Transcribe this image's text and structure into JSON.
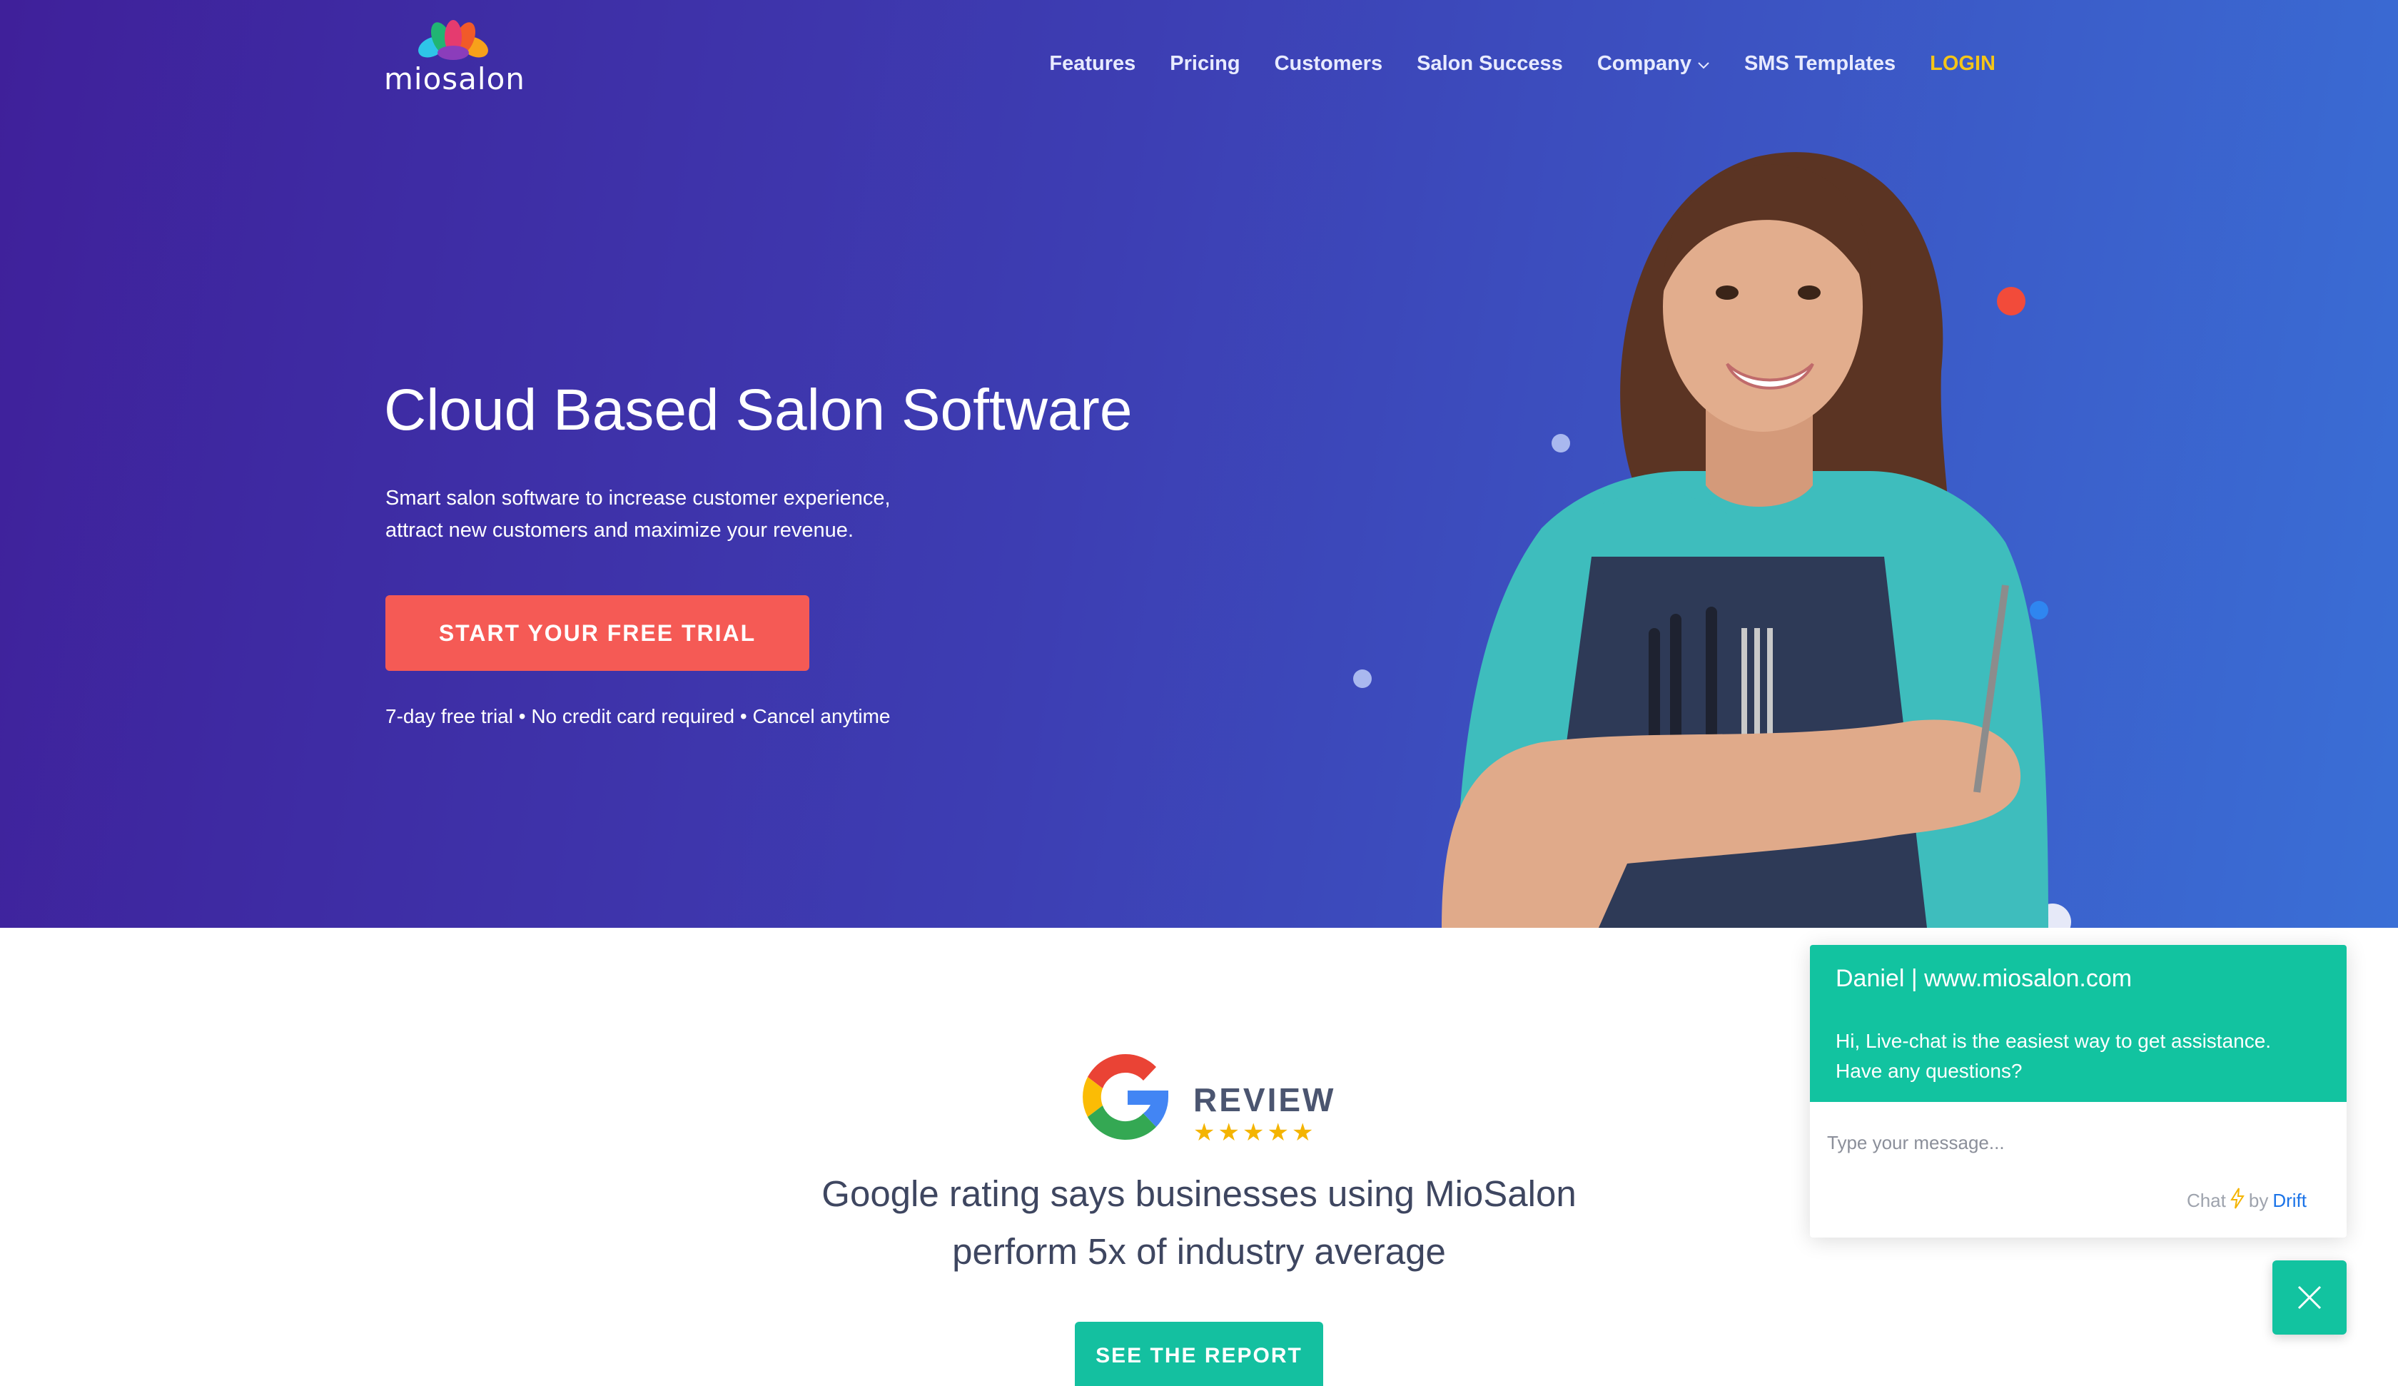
{
  "brand": {
    "name": "miosalon"
  },
  "nav": {
    "items": [
      {
        "label": "Features"
      },
      {
        "label": "Pricing"
      },
      {
        "label": "Customers"
      },
      {
        "label": "Salon Success"
      },
      {
        "label": "Company"
      },
      {
        "label": "SMS Templates"
      }
    ],
    "login_label": "LOGIN"
  },
  "hero": {
    "title": "Cloud Based Salon Software",
    "subtitle_lines": [
      "Smart salon software to increase customer experience,",
      "attract new customers and maximize your revenue."
    ],
    "cta_label": "START YOUR FREE TRIAL",
    "note": "7-day free trial • No credit card required • Cancel anytime"
  },
  "review": {
    "badge_text": "REVIEW",
    "stars": 5,
    "text_lines": [
      "Google rating says businesses using MioSalon",
      "perform 5x of industry average"
    ],
    "button_label": "SEE THE REPORT"
  },
  "chat": {
    "header": "Daniel | www.miosalon.com",
    "message_lines": [
      "Hi, Live-chat is the easiest way to get assistance.",
      "Have any questions?"
    ],
    "input_placeholder": "Type your message...",
    "brand_prefix": "Chat",
    "brand_by": "by",
    "brand_name": "Drift"
  },
  "colors": {
    "cta": "#f55a55",
    "login": "#f5c518",
    "teal": "#12c3a0",
    "star": "#f4b400"
  }
}
